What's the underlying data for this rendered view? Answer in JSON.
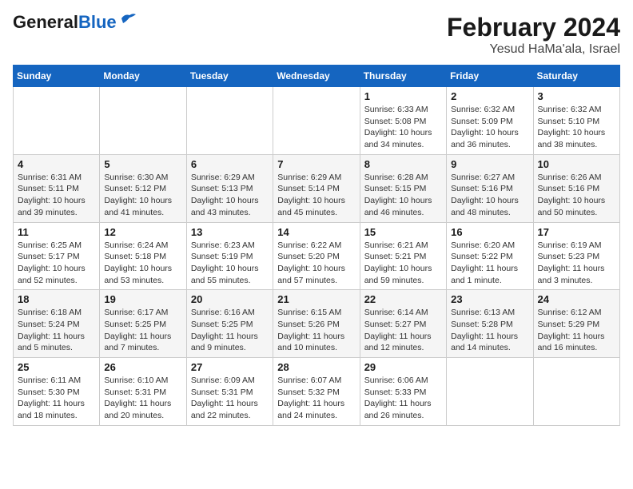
{
  "header": {
    "logo_general": "General",
    "logo_blue": "Blue",
    "month": "February 2024",
    "location": "Yesud HaMa'ala, Israel"
  },
  "weekdays": [
    "Sunday",
    "Monday",
    "Tuesday",
    "Wednesday",
    "Thursday",
    "Friday",
    "Saturday"
  ],
  "weeks": [
    [
      {
        "day": "",
        "info": ""
      },
      {
        "day": "",
        "info": ""
      },
      {
        "day": "",
        "info": ""
      },
      {
        "day": "",
        "info": ""
      },
      {
        "day": "1",
        "info": "Sunrise: 6:33 AM\nSunset: 5:08 PM\nDaylight: 10 hours\nand 34 minutes."
      },
      {
        "day": "2",
        "info": "Sunrise: 6:32 AM\nSunset: 5:09 PM\nDaylight: 10 hours\nand 36 minutes."
      },
      {
        "day": "3",
        "info": "Sunrise: 6:32 AM\nSunset: 5:10 PM\nDaylight: 10 hours\nand 38 minutes."
      }
    ],
    [
      {
        "day": "4",
        "info": "Sunrise: 6:31 AM\nSunset: 5:11 PM\nDaylight: 10 hours\nand 39 minutes."
      },
      {
        "day": "5",
        "info": "Sunrise: 6:30 AM\nSunset: 5:12 PM\nDaylight: 10 hours\nand 41 minutes."
      },
      {
        "day": "6",
        "info": "Sunrise: 6:29 AM\nSunset: 5:13 PM\nDaylight: 10 hours\nand 43 minutes."
      },
      {
        "day": "7",
        "info": "Sunrise: 6:29 AM\nSunset: 5:14 PM\nDaylight: 10 hours\nand 45 minutes."
      },
      {
        "day": "8",
        "info": "Sunrise: 6:28 AM\nSunset: 5:15 PM\nDaylight: 10 hours\nand 46 minutes."
      },
      {
        "day": "9",
        "info": "Sunrise: 6:27 AM\nSunset: 5:16 PM\nDaylight: 10 hours\nand 48 minutes."
      },
      {
        "day": "10",
        "info": "Sunrise: 6:26 AM\nSunset: 5:16 PM\nDaylight: 10 hours\nand 50 minutes."
      }
    ],
    [
      {
        "day": "11",
        "info": "Sunrise: 6:25 AM\nSunset: 5:17 PM\nDaylight: 10 hours\nand 52 minutes."
      },
      {
        "day": "12",
        "info": "Sunrise: 6:24 AM\nSunset: 5:18 PM\nDaylight: 10 hours\nand 53 minutes."
      },
      {
        "day": "13",
        "info": "Sunrise: 6:23 AM\nSunset: 5:19 PM\nDaylight: 10 hours\nand 55 minutes."
      },
      {
        "day": "14",
        "info": "Sunrise: 6:22 AM\nSunset: 5:20 PM\nDaylight: 10 hours\nand 57 minutes."
      },
      {
        "day": "15",
        "info": "Sunrise: 6:21 AM\nSunset: 5:21 PM\nDaylight: 10 hours\nand 59 minutes."
      },
      {
        "day": "16",
        "info": "Sunrise: 6:20 AM\nSunset: 5:22 PM\nDaylight: 11 hours\nand 1 minute."
      },
      {
        "day": "17",
        "info": "Sunrise: 6:19 AM\nSunset: 5:23 PM\nDaylight: 11 hours\nand 3 minutes."
      }
    ],
    [
      {
        "day": "18",
        "info": "Sunrise: 6:18 AM\nSunset: 5:24 PM\nDaylight: 11 hours\nand 5 minutes."
      },
      {
        "day": "19",
        "info": "Sunrise: 6:17 AM\nSunset: 5:25 PM\nDaylight: 11 hours\nand 7 minutes."
      },
      {
        "day": "20",
        "info": "Sunrise: 6:16 AM\nSunset: 5:25 PM\nDaylight: 11 hours\nand 9 minutes."
      },
      {
        "day": "21",
        "info": "Sunrise: 6:15 AM\nSunset: 5:26 PM\nDaylight: 11 hours\nand 10 minutes."
      },
      {
        "day": "22",
        "info": "Sunrise: 6:14 AM\nSunset: 5:27 PM\nDaylight: 11 hours\nand 12 minutes."
      },
      {
        "day": "23",
        "info": "Sunrise: 6:13 AM\nSunset: 5:28 PM\nDaylight: 11 hours\nand 14 minutes."
      },
      {
        "day": "24",
        "info": "Sunrise: 6:12 AM\nSunset: 5:29 PM\nDaylight: 11 hours\nand 16 minutes."
      }
    ],
    [
      {
        "day": "25",
        "info": "Sunrise: 6:11 AM\nSunset: 5:30 PM\nDaylight: 11 hours\nand 18 minutes."
      },
      {
        "day": "26",
        "info": "Sunrise: 6:10 AM\nSunset: 5:31 PM\nDaylight: 11 hours\nand 20 minutes."
      },
      {
        "day": "27",
        "info": "Sunrise: 6:09 AM\nSunset: 5:31 PM\nDaylight: 11 hours\nand 22 minutes."
      },
      {
        "day": "28",
        "info": "Sunrise: 6:07 AM\nSunset: 5:32 PM\nDaylight: 11 hours\nand 24 minutes."
      },
      {
        "day": "29",
        "info": "Sunrise: 6:06 AM\nSunset: 5:33 PM\nDaylight: 11 hours\nand 26 minutes."
      },
      {
        "day": "",
        "info": ""
      },
      {
        "day": "",
        "info": ""
      }
    ]
  ]
}
